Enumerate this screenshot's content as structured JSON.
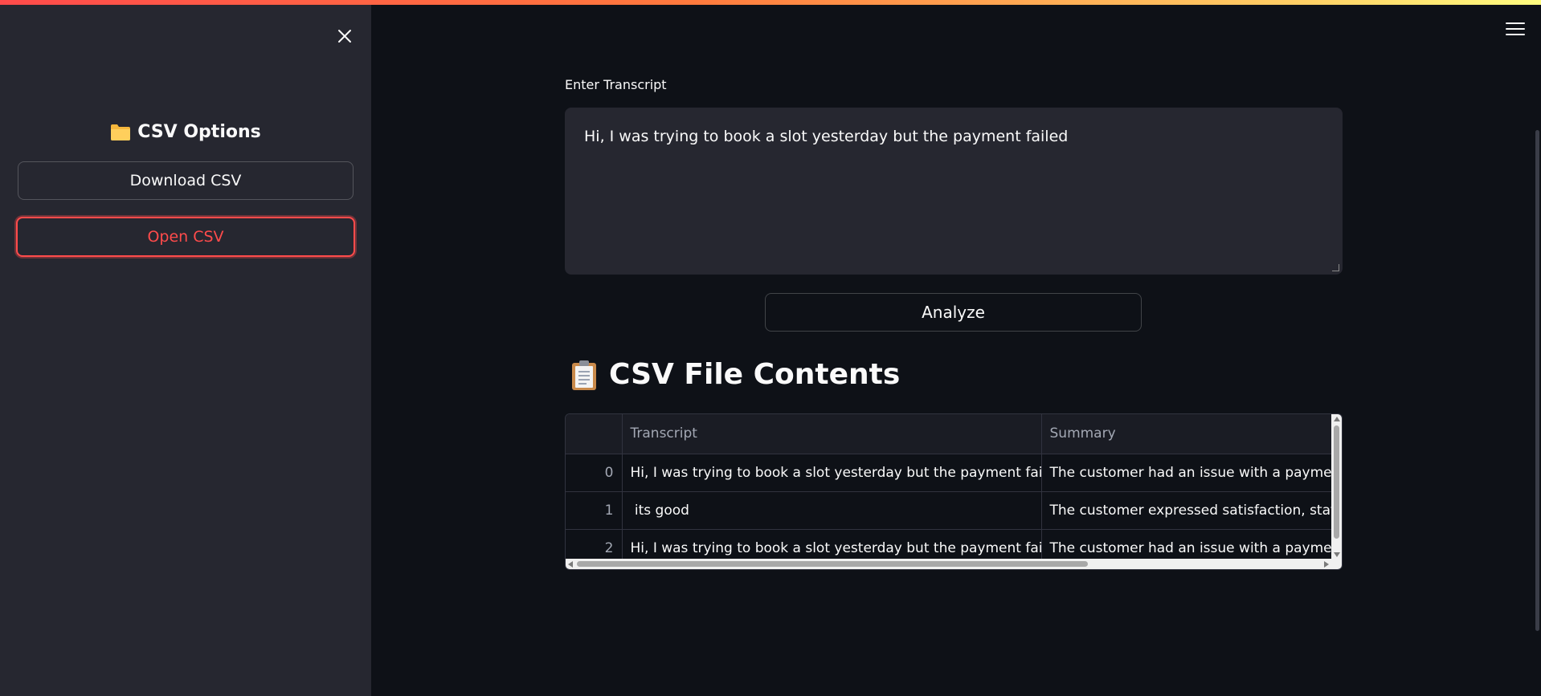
{
  "sidebar": {
    "title": "CSV Options",
    "title_icon": "folder-icon",
    "download_label": "Download CSV",
    "open_label": "Open CSV"
  },
  "main": {
    "transcript_label": "Enter Transcript",
    "transcript_value": "Hi, I was trying to book a slot yesterday but the payment failed",
    "analyze_label": "Analyze",
    "section_heading": "CSV File Contents",
    "section_icon": "clipboard-icon"
  },
  "table": {
    "columns": [
      "",
      "Transcript",
      "Summary"
    ],
    "rows": [
      {
        "index": "0",
        "transcript": "Hi, I was trying to book a slot yesterday but the payment failed",
        "summary": "The customer had an issue with a payment f"
      },
      {
        "index": "1",
        "transcript": " its good",
        "summary": "The customer expressed satisfaction, stating"
      },
      {
        "index": "2",
        "transcript": "Hi, I was trying to book a slot yesterday but the payment failed",
        "summary": "The customer had an issue with a payment f"
      }
    ]
  },
  "colors": {
    "accent": "#ff4b4b",
    "background": "#0e1117",
    "sidebar": "#262730"
  }
}
